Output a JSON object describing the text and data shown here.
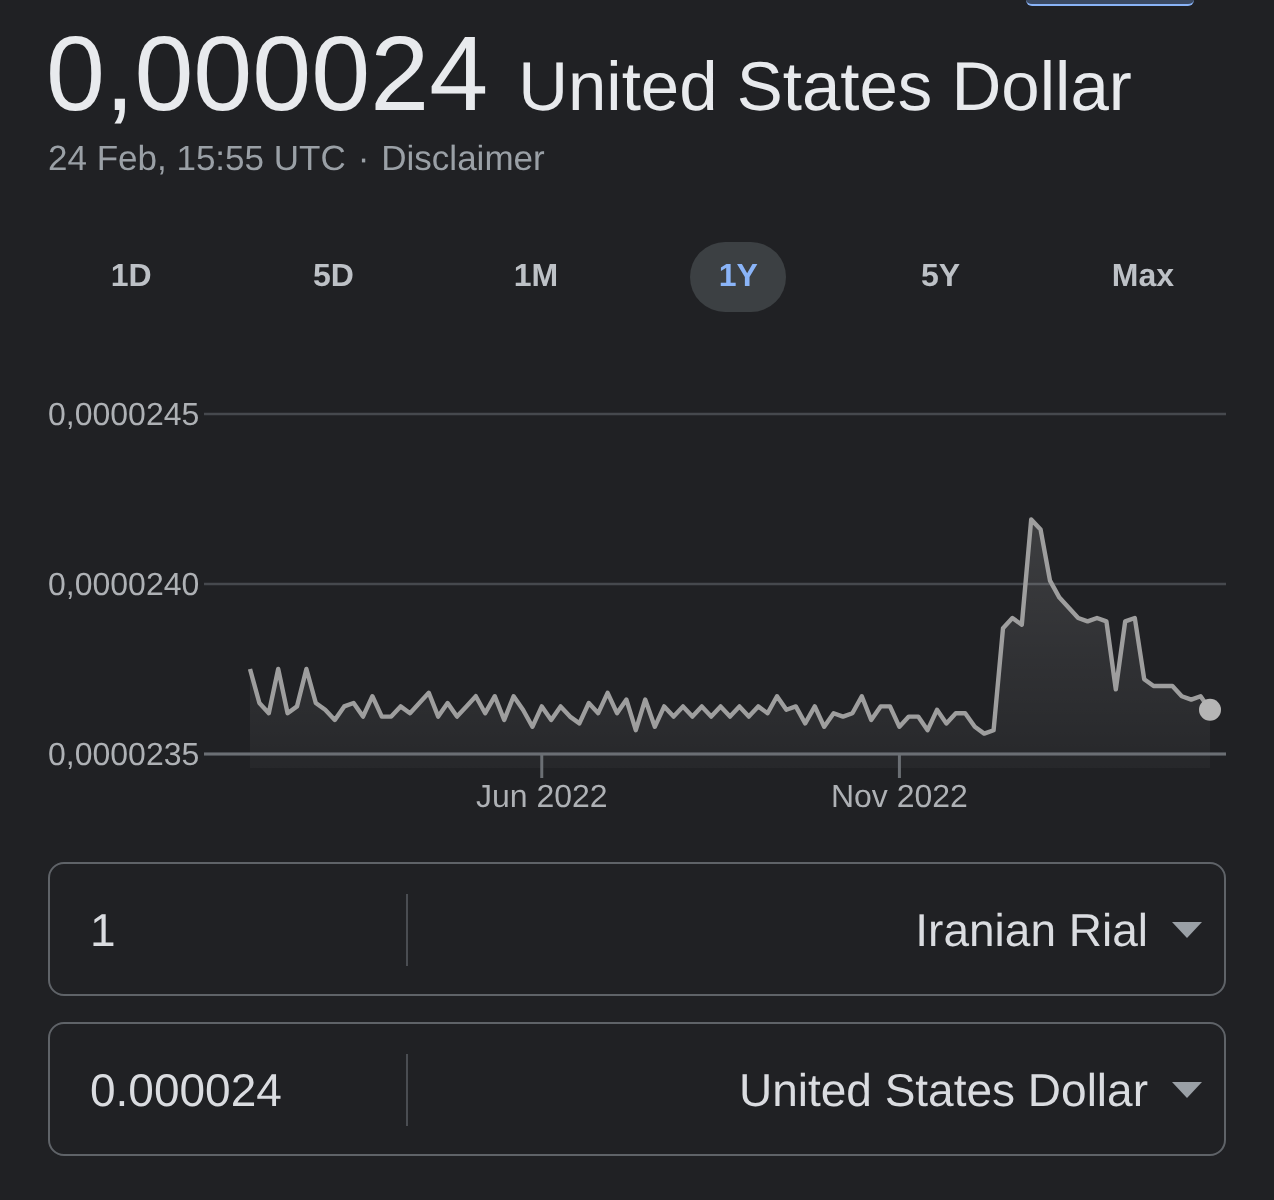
{
  "rate": {
    "value": "0,000024",
    "currency": "United States Dollar",
    "timestamp": "24 Feb, 15:55 UTC",
    "separator": "·",
    "disclaimer_link": "Disclaimer"
  },
  "ranges": [
    {
      "label": "1D",
      "selected": false
    },
    {
      "label": "5D",
      "selected": false
    },
    {
      "label": "1M",
      "selected": false
    },
    {
      "label": "1Y",
      "selected": true
    },
    {
      "label": "5Y",
      "selected": false
    },
    {
      "label": "Max",
      "selected": false
    }
  ],
  "chart": {
    "chart_data": {
      "type": "area",
      "categories": [
        null,
        null,
        null,
        null,
        null,
        null,
        null,
        null,
        null,
        null,
        null,
        null,
        null,
        null,
        null,
        null,
        null,
        null,
        null,
        null,
        null,
        null,
        null,
        null,
        null,
        null,
        null,
        null,
        null,
        null,
        null,
        "Jun 2022",
        null,
        null,
        null,
        null,
        null,
        null,
        null,
        null,
        null,
        null,
        null,
        null,
        null,
        null,
        null,
        null,
        null,
        null,
        null,
        null,
        null,
        null,
        null,
        null,
        null,
        null,
        null,
        null,
        null,
        null,
        null,
        null,
        null,
        null,
        null,
        null,
        null,
        "Nov 2022",
        null,
        null,
        null,
        null,
        null,
        null,
        null,
        null,
        null,
        null,
        null,
        null,
        null,
        null,
        null,
        null,
        null,
        null,
        null,
        null,
        null,
        null,
        null,
        null,
        null,
        null,
        null,
        null,
        null,
        null,
        null,
        null,
        null
      ],
      "values": [
        2.375e-05,
        2.365e-05,
        2.362e-05,
        2.375e-05,
        2.362e-05,
        2.364e-05,
        2.375e-05,
        2.365e-05,
        2.363e-05,
        2.36e-05,
        2.364e-05,
        2.365e-05,
        2.361e-05,
        2.367e-05,
        2.361e-05,
        2.361e-05,
        2.364e-05,
        2.362e-05,
        2.365e-05,
        2.368e-05,
        2.361e-05,
        2.365e-05,
        2.361e-05,
        2.364e-05,
        2.367e-05,
        2.362e-05,
        2.367e-05,
        2.36e-05,
        2.367e-05,
        2.363e-05,
        2.358e-05,
        2.364e-05,
        2.36e-05,
        2.364e-05,
        2.361e-05,
        2.359e-05,
        2.365e-05,
        2.362e-05,
        2.368e-05,
        2.362e-05,
        2.366e-05,
        2.357e-05,
        2.366e-05,
        2.358e-05,
        2.364e-05,
        2.361e-05,
        2.364e-05,
        2.361e-05,
        2.364e-05,
        2.361e-05,
        2.364e-05,
        2.361e-05,
        2.364e-05,
        2.361e-05,
        2.364e-05,
        2.362e-05,
        2.367e-05,
        2.363e-05,
        2.364e-05,
        2.359e-05,
        2.364e-05,
        2.358e-05,
        2.362e-05,
        2.361e-05,
        2.362e-05,
        2.367e-05,
        2.36e-05,
        2.364e-05,
        2.364e-05,
        2.358e-05,
        2.361e-05,
        2.361e-05,
        2.357e-05,
        2.363e-05,
        2.359e-05,
        2.362e-05,
        2.362e-05,
        2.358e-05,
        2.356e-05,
        2.357e-05,
        2.387e-05,
        2.39e-05,
        2.388e-05,
        2.419e-05,
        2.416e-05,
        2.401e-05,
        2.396e-05,
        2.393e-05,
        2.39e-05,
        2.389e-05,
        2.39e-05,
        2.389e-05,
        2.369e-05,
        2.389e-05,
        2.39e-05,
        2.372e-05,
        2.37e-05,
        2.37e-05,
        2.37e-05,
        2.367e-05,
        2.366e-05,
        2.367e-05,
        2.363e-05
      ],
      "ylim": [
        2.35e-05,
        2.45e-05
      ],
      "yticks": [
        {
          "value": 2.45e-05,
          "label": "0,0000245"
        },
        {
          "value": 2.4e-05,
          "label": "0,0000240"
        },
        {
          "value": 2.35e-05,
          "label": "0,0000235"
        }
      ]
    }
  },
  "converter": [
    {
      "amount": "1",
      "currency": "Iranian Rial"
    },
    {
      "amount": "0.000024",
      "currency": "United States Dollar"
    }
  ]
}
